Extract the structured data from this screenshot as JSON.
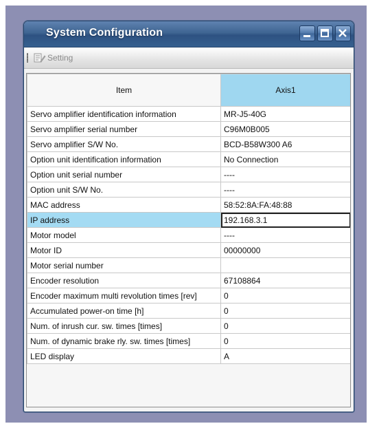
{
  "window": {
    "title": "System Configuration"
  },
  "toolbar": {
    "setting_label": "Setting"
  },
  "table": {
    "headers": [
      "Item",
      "Axis1"
    ],
    "rows": [
      {
        "item": "Servo amplifier identification information",
        "value": "MR-J5-40G"
      },
      {
        "item": "Servo amplifier serial number",
        "value": "C96M0B005"
      },
      {
        "item": "Servo amplifier S/W No.",
        "value": "BCD-B58W300 A6"
      },
      {
        "item": "Option unit identification information",
        "value": "No Connection"
      },
      {
        "item": "Option unit serial number",
        "value": "----"
      },
      {
        "item": "Option unit S/W No.",
        "value": "----"
      },
      {
        "item": "MAC address",
        "value": "58:52:8A:FA:48:88"
      },
      {
        "item": "IP address",
        "value": "192.168.3.1"
      },
      {
        "item": "Motor model",
        "value": "----"
      },
      {
        "item": "Motor ID",
        "value": "00000000"
      },
      {
        "item": "Motor serial number",
        "value": ""
      },
      {
        "item": "Encoder resolution",
        "value": "67108864"
      },
      {
        "item": "Encoder maximum multi revolution times [rev]",
        "value": "0"
      },
      {
        "item": "Accumulated power-on time [h]",
        "value": "0"
      },
      {
        "item": "Num. of inrush cur. sw. times [times]",
        "value": "0"
      },
      {
        "item": "Num. of dynamic brake rly. sw. times [times]",
        "value": "0"
      },
      {
        "item": "LED display",
        "value": "A"
      }
    ],
    "selected_row": "IP address"
  },
  "colors": {
    "titlebar": "#3f6592",
    "header_axis": "#9fd7f0",
    "selected_label": "#a4dbf3"
  },
  "icons": [
    "minimize-icon",
    "maximize-icon",
    "close-icon",
    "setting-icon"
  ]
}
